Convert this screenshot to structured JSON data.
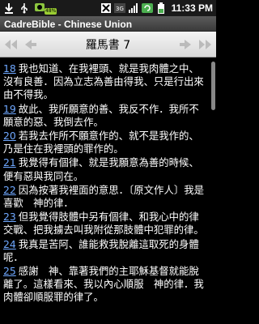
{
  "status": {
    "battery_percent": "48%",
    "network": "3G",
    "time": "11:33 PM"
  },
  "app": {
    "title": "CadreBible - Chinese Union"
  },
  "nav": {
    "chapter_title": "羅馬書 7"
  },
  "verses": [
    {
      "num": "18",
      "text": "我也知道、在我裡頭、就是我肉體之中、沒有良善．因為立志為善由得我、只是行出來由不得我。"
    },
    {
      "num": "19",
      "text": "故此、我所願意的善、我反不作．我所不願意的惡、我倒去作。"
    },
    {
      "num": "20",
      "text": "若我去作所不願意作的、就不是我作的、乃是住在我裡頭的罪作的。"
    },
    {
      "num": "21",
      "text": "我覺得有個律、就是我願意為善的時候、便有惡與我同在。"
    },
    {
      "num": "22",
      "text": "因為按著我裡面的意思．〔原文作人〕我是喜歡　神的律．"
    },
    {
      "num": "23",
      "text": "但我覺得肢體中另有個律、和我心中的律交戰、把我擄去叫我附從那肢體中犯罪的律。"
    },
    {
      "num": "24",
      "text": "我真是苦阿、誰能救我脫離這取死的身體呢．"
    },
    {
      "num": "25",
      "text": "感謝　神、靠著我們的主耶穌基督就能脫離了。這樣看來、我以內心順服　神的律．我肉體卻順服罪的律了。"
    }
  ],
  "colors": {
    "verse_number": "#6fa8ff",
    "background": "#000000",
    "text": "#ffffff"
  }
}
